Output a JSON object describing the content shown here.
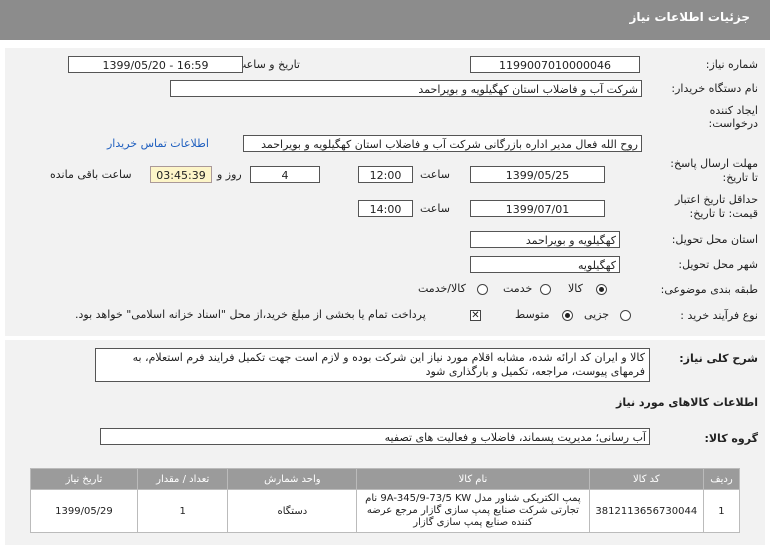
{
  "header": {
    "title": "جزئیات اطلاعات نیاز"
  },
  "fields": {
    "need_number_label": "شماره نیاز:",
    "need_number": "1199007010000046",
    "announce_label": "تاریخ و ساعت اعلان عمومی:",
    "announce_value": "1399/05/20 - 16:59",
    "buyer_label": "نام دستگاه خریدار:",
    "buyer_value": "شرکت آب و فاضلاب استان کهگیلویه و بویراحمد",
    "creator_label_1": "ایجاد کننده",
    "creator_label_2": "درخواست:",
    "creator_value": "روح الله فعال مدیر اداره بازرگانی شرکت آب و فاضلاب استان کهگیلویه و بویراحمد",
    "contact_link": "اطلاعات تماس خریدار",
    "deadline_label_1": "مهلت ارسال پاسخ:",
    "deadline_label_2": "تا تاریخ:",
    "deadline_date": "1399/05/25",
    "time_label": "ساعت",
    "deadline_time": "12:00",
    "days_value": "4",
    "days_label": "روز و",
    "remaining_timer": "03:45:39",
    "remaining_label": "ساعت باقی مانده",
    "validity_label_1": "حداقل تاریخ اعتبار",
    "validity_label_2": "قیمت: تا تاریخ:",
    "validity_date": "1399/07/01",
    "validity_time_label": "ساعت",
    "validity_time": "14:00",
    "province_label": "استان محل تحویل:",
    "province_value": "کهگیلویه و بویراحمد",
    "city_label": "شهر محل تحویل:",
    "city_value": "کهگیلویه",
    "category_label": "طبقه بندی موضوعی:",
    "category_options": [
      "کالا",
      "خدمت",
      "کالا/خدمت"
    ],
    "category_selected": "کالا",
    "process_label": "نوع فرآیند خرید :",
    "process_options": [
      "جزیی",
      "متوسط"
    ],
    "process_selected": "متوسط",
    "payment_note": "پرداخت تمام یا بخشی از مبلغ خرید،از محل \"اسناد خزانه اسلامی\" خواهد بود."
  },
  "description": {
    "label": "شرح کلی نیاز:",
    "text": "کالا و ایران کد ارائه شده، مشابه اقلام مورد نیاز این شرکت بوده و لازم است جهت تکمیل فرایند فرم استعلام، به فرمهای پیوست، مراجعه، تکمیل و بارگذاری شود"
  },
  "goods": {
    "section_title": "اطلاعات کالاهای مورد نیاز",
    "group_label": "گروه کالا:",
    "group_value": "آب رسانی؛ مدیریت پسماند، فاضلاب و فعالیت های تصفیه",
    "columns": [
      "ردیف",
      "کد کالا",
      "نام کالا",
      "واحد شمارش",
      "تعداد / مقدار",
      "تاریخ نیاز"
    ],
    "rows": [
      {
        "index": "1",
        "code": "3812113656730044",
        "name": "پمپ الکتریکی شناور مدل 9A-345/9-73/5 KW نام تجارتی شرکت صنایع پمپ سازی گازار مرجع عرضه کننده صنایع پمپ سازی گازار",
        "unit": "دستگاه",
        "qty": "1",
        "date": "1399/05/29"
      }
    ]
  }
}
